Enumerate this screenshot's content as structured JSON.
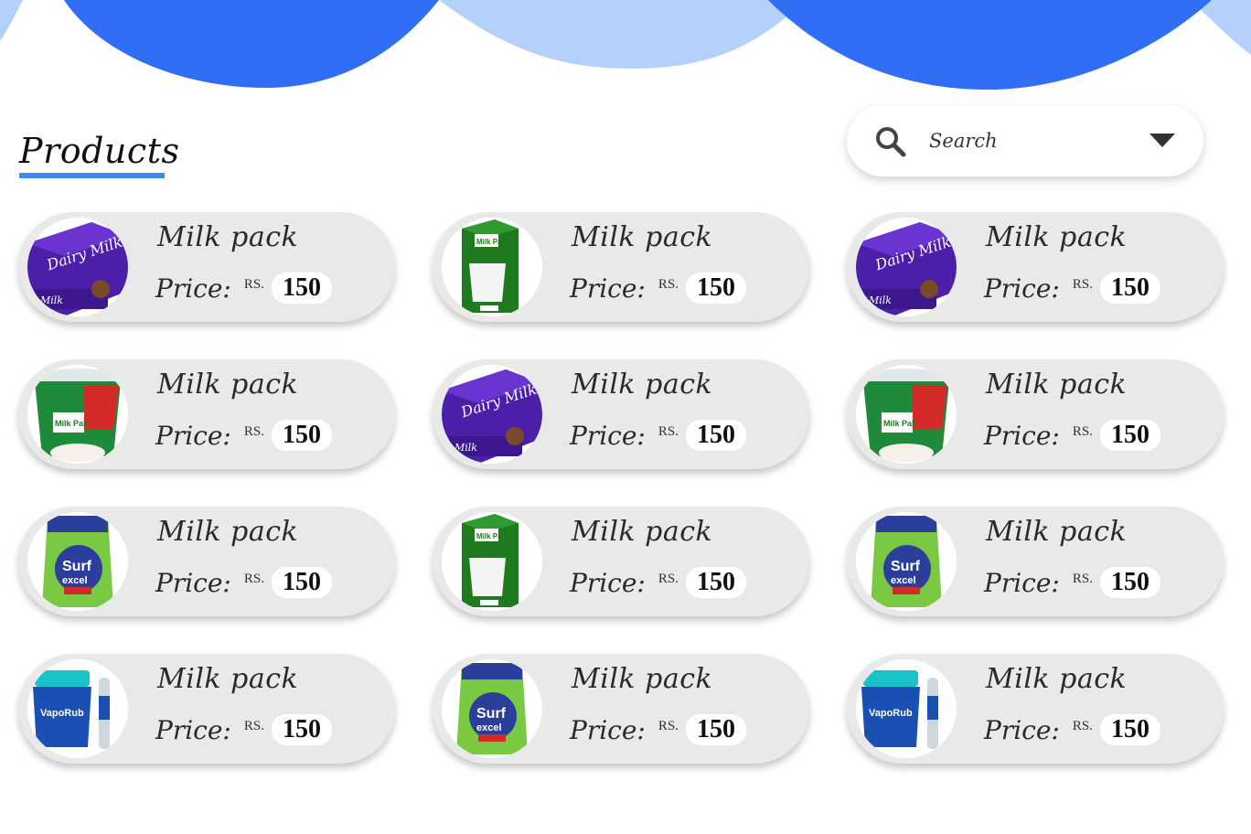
{
  "page": {
    "title": "Products"
  },
  "colors": {
    "wave_dark": "#2f6ef5",
    "wave_light": "#b3d1fb",
    "underline": "#3d8bf2",
    "card_bg": "#e9e9e9"
  },
  "search": {
    "placeholder": "Search",
    "icon": "search-icon",
    "dropdown_icon": "chevron-down-icon"
  },
  "products": [
    {
      "name": "Milk pack",
      "price_label": "Price:",
      "currency": "RS.",
      "price": "150",
      "image": "dairy-milk-box"
    },
    {
      "name": "Milk pack",
      "price_label": "Price:",
      "currency": "RS.",
      "price": "150",
      "image": "milk-pak-carton"
    },
    {
      "name": "Milk pack",
      "price_label": "Price:",
      "currency": "RS.",
      "price": "150",
      "image": "dairy-milk-box"
    },
    {
      "name": "Milk pack",
      "price_label": "Price:",
      "currency": "RS.",
      "price": "150",
      "image": "milk-pak-yogurt"
    },
    {
      "name": "Milk pack",
      "price_label": "Price:",
      "currency": "RS.",
      "price": "150",
      "image": "dairy-milk-box"
    },
    {
      "name": "Milk pack",
      "price_label": "Price:",
      "currency": "RS.",
      "price": "150",
      "image": "milk-pak-yogurt"
    },
    {
      "name": "Milk pack",
      "price_label": "Price:",
      "currency": "RS.",
      "price": "150",
      "image": "surf-excel-pack"
    },
    {
      "name": "Milk pack",
      "price_label": "Price:",
      "currency": "RS.",
      "price": "150",
      "image": "milk-pak-carton"
    },
    {
      "name": "Milk pack",
      "price_label": "Price:",
      "currency": "RS.",
      "price": "150",
      "image": "surf-excel-pack"
    },
    {
      "name": "Milk pack",
      "price_label": "Price:",
      "currency": "RS.",
      "price": "150",
      "image": "vicks-vaporub"
    },
    {
      "name": "Milk pack",
      "price_label": "Price:",
      "currency": "RS.",
      "price": "150",
      "image": "surf-excel-pack"
    },
    {
      "name": "Milk pack",
      "price_label": "Price:",
      "currency": "RS.",
      "price": "150",
      "image": "vicks-vaporub"
    }
  ]
}
